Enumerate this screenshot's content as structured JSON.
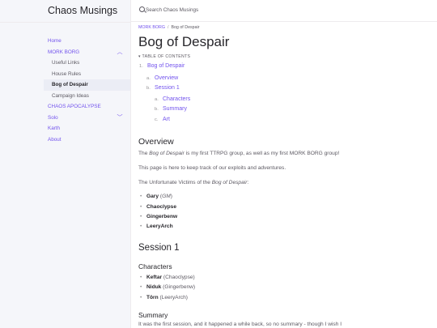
{
  "site": {
    "title": "Chaos Musings"
  },
  "search": {
    "placeholder": "Search Chaos Musings"
  },
  "sidebar": {
    "items": [
      {
        "label": "Home"
      },
      {
        "label": "MORK BORG"
      },
      {
        "label": "Useful Links"
      },
      {
        "label": "House Rules"
      },
      {
        "label": "Bog of Despair"
      },
      {
        "label": "Campaign Ideas"
      },
      {
        "label": "CHAOS APOCALYPSE"
      },
      {
        "label": "Solo"
      },
      {
        "label": "Karth"
      },
      {
        "label": "About"
      }
    ]
  },
  "breadcrumb": {
    "parent": "MORK BORG",
    "current": "Bog of Despair"
  },
  "page": {
    "title": "Bog of Despair",
    "toc_label": "▾ TABLE OF CONTENTS",
    "toc": [
      {
        "marker": "1.",
        "label": "Bog of Despair"
      },
      {
        "marker": "a.",
        "label": "Overview"
      },
      {
        "marker": "b.",
        "label": "Session 1"
      },
      {
        "marker": "a.",
        "label": "Characters"
      },
      {
        "marker": "b.",
        "label": "Summary"
      },
      {
        "marker": "c.",
        "label": "Art"
      }
    ],
    "overview": {
      "heading": "Overview",
      "p1_a": "The ",
      "p1_em": "Bog of Despair",
      "p1_b": " is my first TTRPG group, as well as my first MORK BORG group!",
      "p2": "This page is here to keep track of our exploits and adventures.",
      "p3_a": "The Unfortunate Victims of the ",
      "p3_em": "Bog of Despair",
      "p3_b": ":",
      "victims": [
        {
          "name": "Gary",
          "note_open": " (",
          "note": "GM",
          "note_close": ")"
        },
        {
          "name": "Chaoclypse"
        },
        {
          "name": "Gingerbenw"
        },
        {
          "name": "LeeryArch"
        }
      ]
    },
    "session1": {
      "heading": "Session 1",
      "characters_heading": "Characters",
      "characters": [
        {
          "name": "Keftar",
          "player": " (Chaoclypse)"
        },
        {
          "name": "Niduk",
          "player": " (Gingerbenw)"
        },
        {
          "name": "Törn",
          "player": " (LeeryArch)"
        }
      ],
      "summary_heading": "Summary",
      "summary_text": "It was the first session, and it happened a while back, so no summary - though I wish I"
    }
  }
}
